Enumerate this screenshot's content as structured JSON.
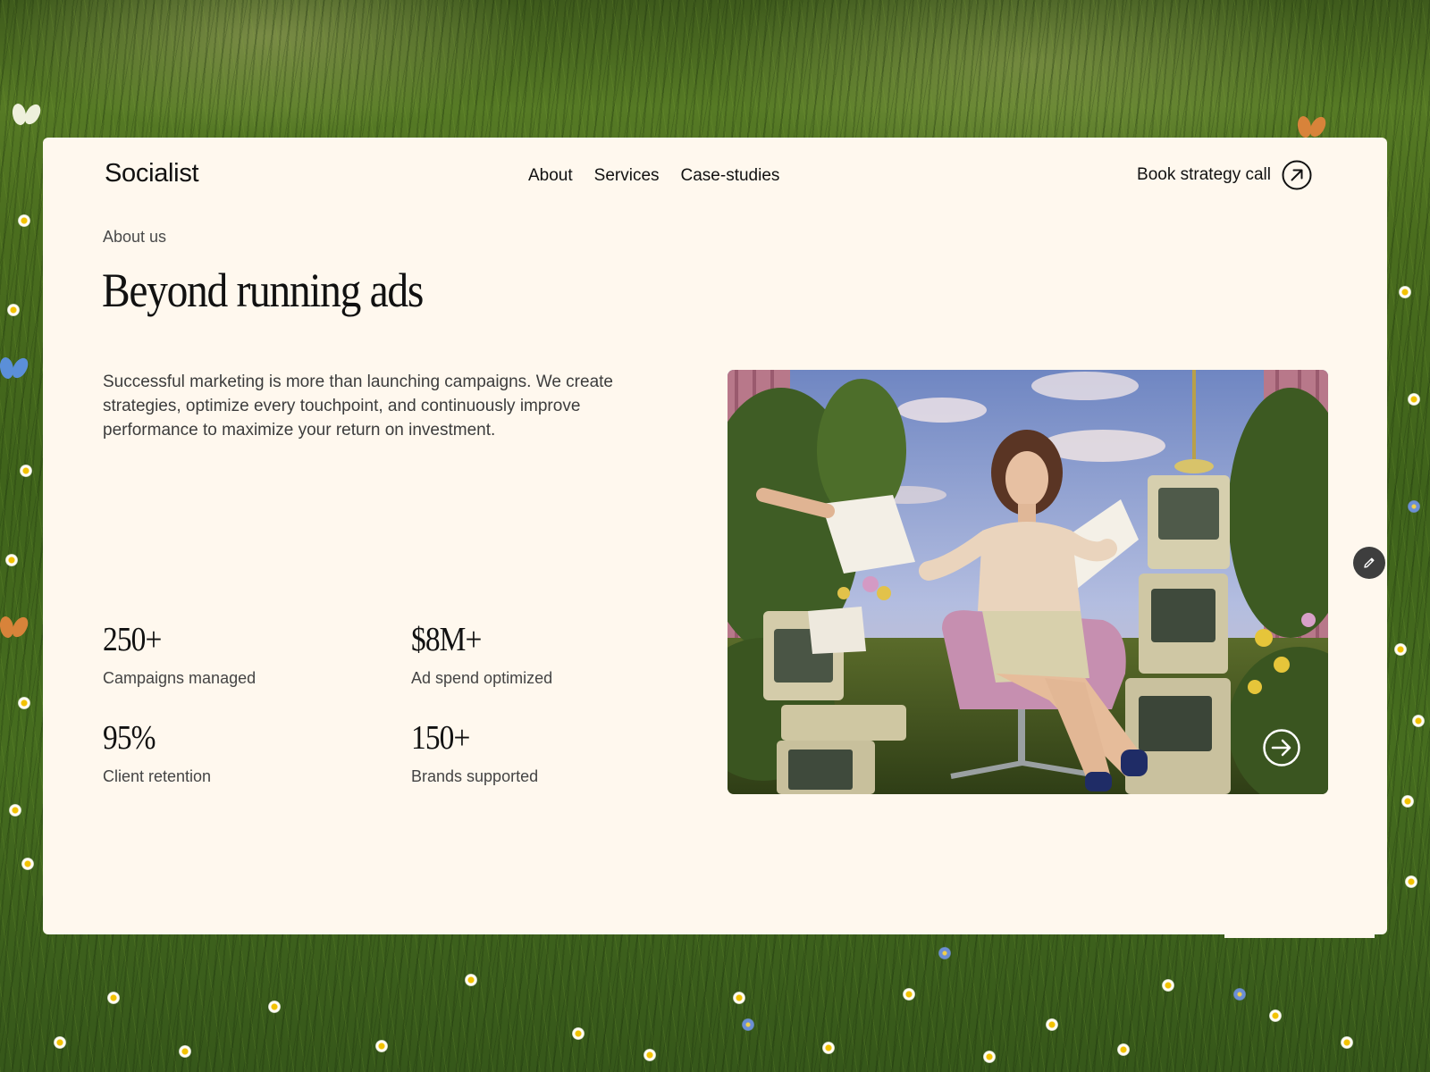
{
  "brand": {
    "name": "Socialist"
  },
  "nav": {
    "links": [
      "About",
      "Services",
      "Case-studies"
    ],
    "cta_label": "Book strategy call"
  },
  "hero": {
    "eyebrow": "About us",
    "title": "Beyond running ads",
    "body": "Successful marketing is more than launching campaigns. We create strategies, optimize every touchpoint, and continuously improve performance to maximize your return on investment."
  },
  "stats": [
    {
      "value": "250+",
      "label": "Campaigns managed"
    },
    {
      "value": "$8M+",
      "label": "Ad spend optimized"
    },
    {
      "value": "95%",
      "label": "Client retention"
    },
    {
      "value": "150+",
      "label": "Brands supported"
    }
  ],
  "icons": {
    "cta": "arrow-up-right-circle-icon",
    "image_next": "arrow-right-circle-icon",
    "edit": "pencil-icon"
  },
  "colors": {
    "card_background": "#fff8ee",
    "text_primary": "#111111",
    "text_secondary": "#444444",
    "edit_button": "#3e3e3e"
  }
}
